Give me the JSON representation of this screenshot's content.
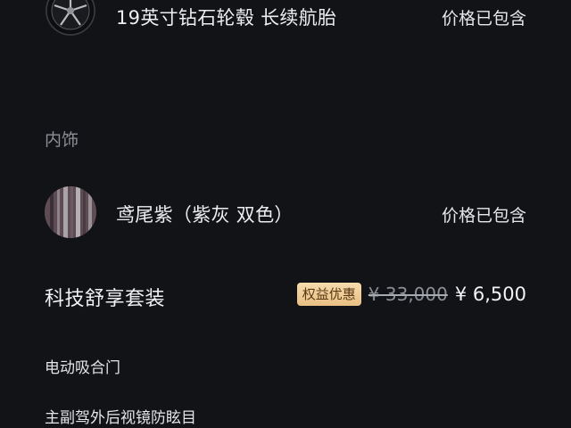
{
  "wheel_option": {
    "icon": "wheel-icon",
    "title": "19英寸钻石轮毂 长续航胎",
    "price_note": "价格已包含"
  },
  "interior_section": {
    "label": "内饰"
  },
  "interior_option": {
    "icon": "color-swatch",
    "title": "鸢尾紫（紫灰 双色）",
    "price_note": "价格已包含",
    "swatch_colors": [
      "#6b5a62",
      "#3b2f36",
      "#a9a3a6"
    ]
  },
  "tech_package": {
    "title": "科技舒享套装",
    "badge": "权益优惠",
    "original_price": "¥ 33,000",
    "current_price": "¥ 6,500",
    "features": [
      "电动吸合门",
      "主副驾外后视镜防眩目"
    ]
  },
  "colors": {
    "background": "#121316",
    "badge_bg": "#efcb95",
    "badge_text": "#5a3a14",
    "muted_text": "#8c8f96"
  }
}
